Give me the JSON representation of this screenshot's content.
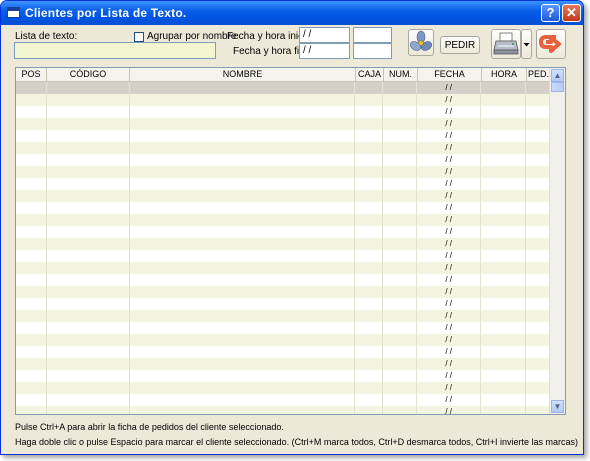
{
  "window": {
    "title": "Clientes por Lista de Texto.",
    "help_label": "?",
    "close_label": "✕"
  },
  "filters": {
    "lista_label": "Lista de texto:",
    "lista_value": "",
    "agrupar_label": "Agrupar por nombre",
    "agrupar_checked": false,
    "fecha_inicial_label": "Fecha y hora inicial:",
    "fecha_inicial_value": " / /",
    "hora_inicial_value": "",
    "fecha_final_label": "Fecha y hora final:",
    "fecha_final_value": " / /",
    "hora_final_value": ""
  },
  "toolbar": {
    "pedir_label": "PEDIR",
    "fan_icon": "fan-icon",
    "printer_icon": "printer-icon",
    "dropdown_icon": "dropdown-arrow-icon",
    "exit_icon": "exit-arrow-icon"
  },
  "grid": {
    "columns": [
      "POS",
      "CÓDIGO",
      "NOMBRE",
      "CAJA",
      "NUM.",
      "FECHA",
      "HORA",
      "PED."
    ],
    "date_placeholder": "/ /",
    "row_count": 28,
    "scroll_up": "▲",
    "scroll_down": "▼"
  },
  "hints": {
    "line1": "Pulse Ctrl+A para abrir la ficha de pedidos del cliente seleccionado.",
    "line2": "Haga doble clic o pulse Espacio para marcar el cliente seleccionado. (Ctrl+M marca todos, Ctrl+D desmarca todos, Ctrl+I invierte las marcas)"
  }
}
